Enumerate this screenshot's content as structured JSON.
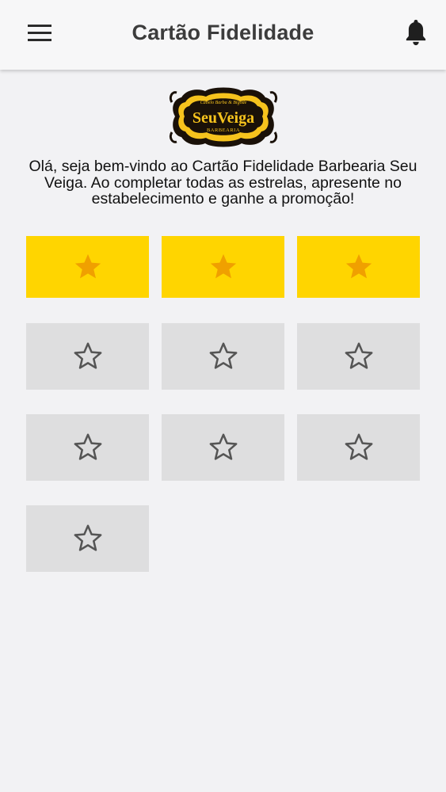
{
  "appbar": {
    "title": "Cartão Fidelidade",
    "menu_icon": "hamburger-menu-icon",
    "notification_icon": "bell-icon"
  },
  "logo": {
    "brand_name": "SeuVeiga",
    "subtitle": "BARBEARIA",
    "tagline": "Cabelo Barba & Bigode"
  },
  "welcome_message": "Olá, seja bem-vindo ao Cartão Fidelidade Barbearia Seu Veiga. Ao completar todas as estrelas, apresente no estabelecimento e ganhe a promoção!",
  "card": {
    "total_stars": 10,
    "stamps": [
      {
        "filled": true
      },
      {
        "filled": true
      },
      {
        "filled": true
      },
      {
        "filled": false
      },
      {
        "filled": false
      },
      {
        "filled": false
      },
      {
        "filled": false
      },
      {
        "filled": false
      },
      {
        "filled": false
      },
      {
        "filled": false
      }
    ]
  },
  "colors": {
    "filled_tile": "#ffd500",
    "filled_star": "#f0a000",
    "empty_tile": "#dededf",
    "empty_star_outline": "#555555"
  }
}
